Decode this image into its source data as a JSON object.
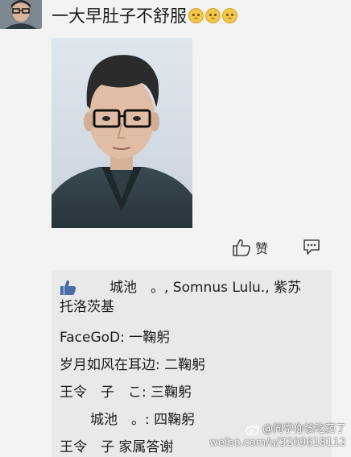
{
  "post": {
    "text": "一大早肚子不舒服",
    "emoji_count": 3,
    "emoji_icon": "worried-face-emoji"
  },
  "actions": {
    "like_label": "赞",
    "like_icon": "thumbs-up-icon",
    "comment_icon": "comment-bubble-icon"
  },
  "comments_section": {
    "likes_line1": "城池　。, Somnus Lulu., 紫苏",
    "likes_line2": "托洛茨基",
    "comments": [
      {
        "text": "FaceGoD: 一鞠躬"
      },
      {
        "text": "岁月如风在耳边: 二鞠躬"
      },
      {
        "text": "王令　子　こ: 三鞠躬"
      },
      {
        "text": "城池　。: 四鞠躬"
      },
      {
        "text": "王令　子 家属答谢"
      }
    ]
  },
  "watermark": {
    "line1": "@同学你该吃药了",
    "line2": "weibo.com/u/3209618112"
  }
}
